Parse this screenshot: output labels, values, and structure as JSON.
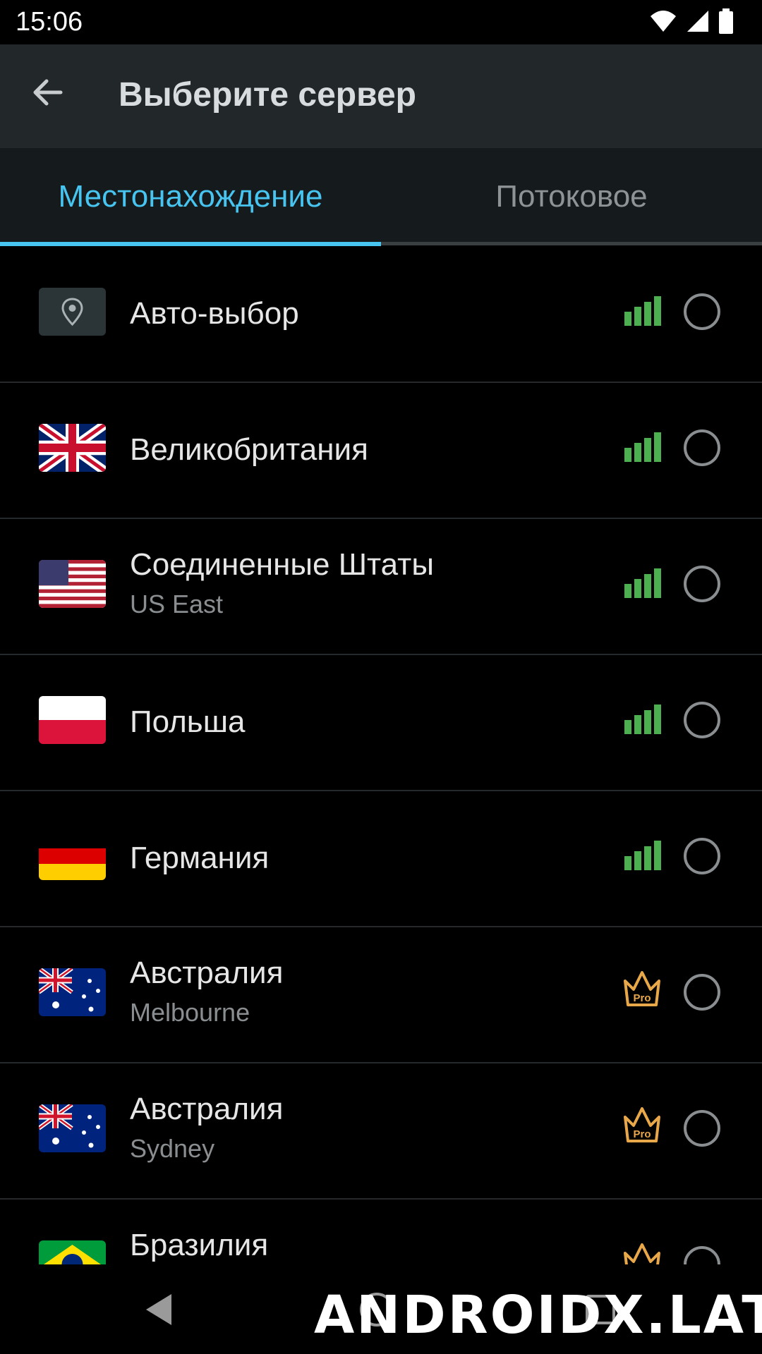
{
  "status_bar": {
    "time": "15:06"
  },
  "toolbar": {
    "title": "Выберите сервер"
  },
  "tabs": [
    {
      "label": "Местонахождение",
      "active": true
    },
    {
      "label": "Потоковое",
      "active": false
    }
  ],
  "servers": [
    {
      "name": "Авто-выбор",
      "sub": "",
      "flag": "auto-location-icon",
      "indicator": "signal"
    },
    {
      "name": "Великобритания",
      "sub": "",
      "flag": "uk-flag",
      "indicator": "signal"
    },
    {
      "name": "Соединенные Штаты",
      "sub": "US East",
      "flag": "us-flag",
      "indicator": "signal"
    },
    {
      "name": "Польша",
      "sub": "",
      "flag": "poland-flag",
      "indicator": "signal"
    },
    {
      "name": "Германия",
      "sub": "",
      "flag": "germany-flag",
      "indicator": "signal"
    },
    {
      "name": "Австралия",
      "sub": "Melbourne",
      "flag": "australia-flag",
      "indicator": "pro"
    },
    {
      "name": "Австралия",
      "sub": "Sydney",
      "flag": "australia-flag",
      "indicator": "pro"
    },
    {
      "name": "Бразилия",
      "sub": "",
      "flag": "brazil-flag",
      "indicator": "pro"
    }
  ],
  "pro_badge_label": "Pro",
  "watermark": "ANDROIDX.LAT",
  "colors": {
    "accent": "#47c4ef",
    "signal": "#4caf50",
    "pro": "#e8a84a",
    "toolbar_bg": "#22272a"
  }
}
